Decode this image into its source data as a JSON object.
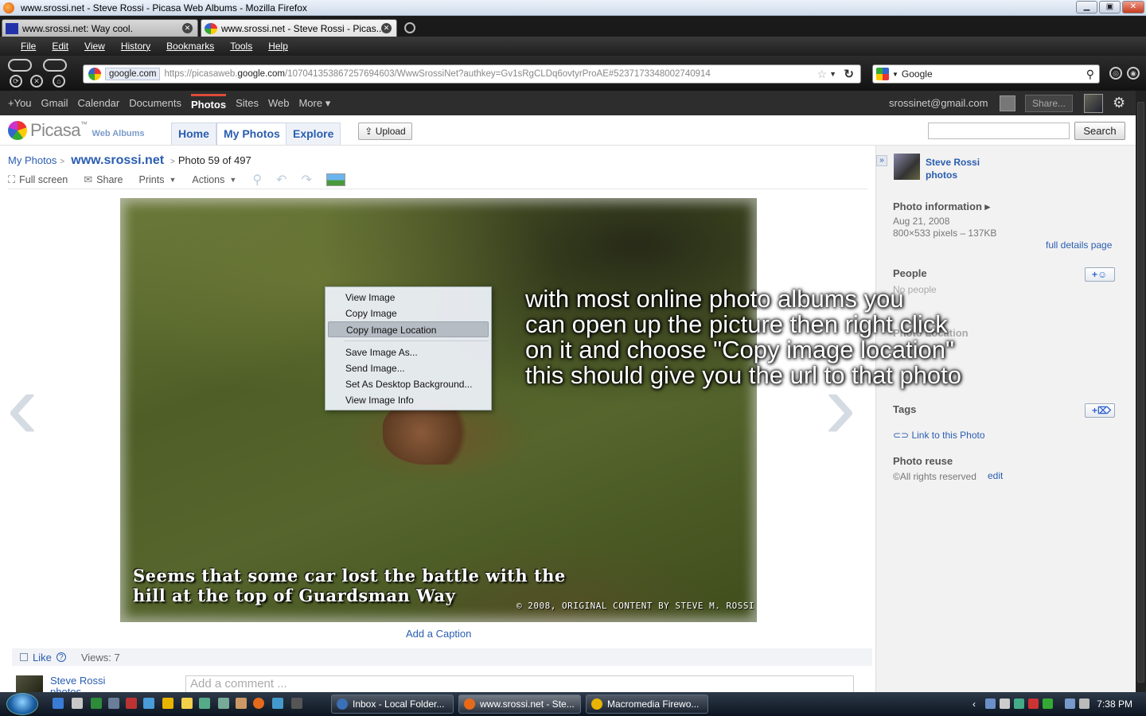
{
  "window": {
    "title": "www.srossi.net - Steve Rossi - Picasa Web Albums - Mozilla Firefox"
  },
  "tabs": [
    {
      "label": "www.srossi.net: Way cool."
    },
    {
      "label": "www.srossi.net - Steve Rossi - Picas..."
    }
  ],
  "menu": [
    "File",
    "Edit",
    "View",
    "History",
    "Bookmarks",
    "Tools",
    "Help"
  ],
  "address": {
    "domain": "google.com",
    "url_prefix": "https://picasaweb.",
    "url_host": "google.com",
    "url_path": "/107041353867257694603/WwwSrossiNet?authkey=Gv1sRgCLDq6ovtyrProAE#5237173348002740914"
  },
  "search_engine": "Google",
  "gbar": {
    "items": [
      "+You",
      "Gmail",
      "Calendar",
      "Documents",
      "Photos",
      "Sites",
      "Web",
      "More ▾"
    ],
    "email": "srossinet@gmail.com",
    "share": "Share..."
  },
  "picasa": {
    "logo": "Picasa",
    "tm": "™",
    "sub": "Web Albums",
    "tabs": [
      "Home",
      "My Photos",
      "Explore"
    ],
    "upload": "Upload",
    "search_btn": "Search"
  },
  "breadcrumb": {
    "root": "My Photos",
    "album": "www.srossi.net",
    "position": "Photo 59 of 497"
  },
  "toolbar": {
    "fullscreen": "Full screen",
    "share": "Share",
    "prints": "Prints",
    "actions": "Actions"
  },
  "photo": {
    "caption_line1": "Seems that some car lost the battle with the",
    "caption_line2": "hill at the top of Guardsman Way",
    "copyright": "© 2008, ORIGINAL CONTENT BY STEVE M. ROSSI"
  },
  "context_menu": [
    "View Image",
    "Copy Image",
    "Copy Image Location",
    "Save Image As...",
    "Send Image...",
    "Set As Desktop Background...",
    "View Image Info"
  ],
  "annotation": [
    "with most online photo albums you",
    "can open up the picture then right click",
    "on it and choose \"Copy image location\"",
    "this should give you the url to that photo"
  ],
  "add_caption": "Add a Caption",
  "like": {
    "label": "Like",
    "views": "Views: 7"
  },
  "comment": {
    "name_line1": "Steve Rossi",
    "name_line2": "photos",
    "placeholder": "Add a comment ..."
  },
  "sidebar": {
    "owner_name": "Steve Rossi",
    "owner_sub": "photos",
    "photo_info_title": "Photo information ▸",
    "date": "Aug 21, 2008",
    "dims": "800×533 pixels – 137KB",
    "full_details": "full details page",
    "people_title": "People",
    "no_people": "No people",
    "photo_location": "Photo Location",
    "tags_title": "Tags",
    "link_photo": "Link to this Photo",
    "reuse_title": "Photo reuse",
    "rights": "All rights reserved",
    "edit": "edit"
  },
  "taskbar": {
    "buttons": [
      "Inbox - Local Folder...",
      "www.srossi.net - Ste...",
      "Macromedia Firewo..."
    ],
    "clock": "7:38 PM"
  }
}
